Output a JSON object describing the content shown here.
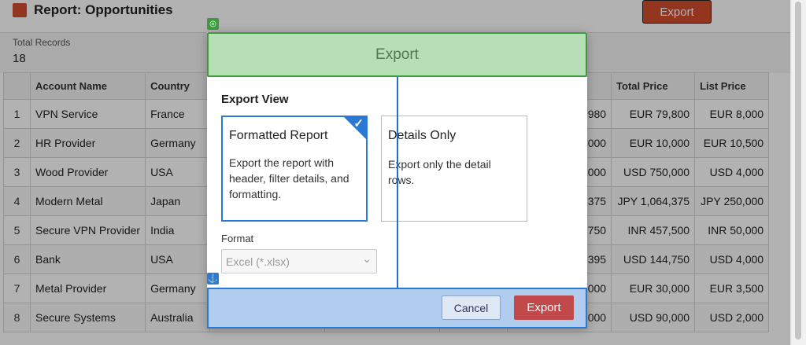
{
  "report": {
    "title": "Report: Opportunities",
    "export_label": "Export",
    "total_records_label": "Total Records",
    "total_records_value": "18"
  },
  "table": {
    "columns": [
      "",
      "Account Name",
      "Country",
      "",
      "",
      "",
      "",
      "Total Price",
      "List Price"
    ],
    "rows": [
      [
        "1",
        "VPN Service",
        "France",
        "",
        "",
        "",
        "980",
        "EUR 79,800",
        "EUR 8,000"
      ],
      [
        "2",
        "HR Provider",
        "Germany",
        "",
        "",
        "",
        "000",
        "EUR 10,000",
        "EUR 10,500"
      ],
      [
        "3",
        "Wood Provider",
        "USA",
        "",
        "",
        "",
        "000",
        "USD 750,000",
        "USD 4,000"
      ],
      [
        "4",
        "Modern Metal",
        "Japan",
        "",
        "",
        "",
        "375",
        "JPY 1,064,375",
        "JPY 250,000"
      ],
      [
        "5",
        "Secure VPN Provider",
        "India",
        "",
        "",
        "",
        "750",
        "INR 457,500",
        "INR 50,000"
      ],
      [
        "6",
        "Bank",
        "USA",
        "",
        "",
        "",
        "395",
        "USD 144,750",
        "USD 4,000"
      ],
      [
        "7",
        "Metal Provider",
        "Germany",
        "",
        "",
        "",
        "000",
        "EUR 30,000",
        "EUR 3,500"
      ],
      [
        "8",
        "Secure Systems",
        "Australia",
        "",
        "",
        "",
        "000",
        "USD 90,000",
        "USD 2,000"
      ]
    ]
  },
  "modal": {
    "title": "Export",
    "section_label": "Export View",
    "options": [
      {
        "title": "Formatted Report",
        "description": "Export the report with header, filter details, and formatting.",
        "selected": true
      },
      {
        "title": "Details Only",
        "description": "Export only the detail rows.",
        "selected": false
      }
    ],
    "format_label": "Format",
    "format_value": "Excel (*.xlsx)",
    "cancel_label": "Cancel",
    "export_label": "Export"
  },
  "colors": {
    "accent": "#2a7ad5",
    "header_fill": "#b6dfb6",
    "header_border": "#3e9a3e",
    "footer_fill": "#b0cdf0",
    "export_button": "#c2494a",
    "brand": "#d44c2d"
  },
  "icons": {
    "header_marker": "target-icon",
    "footer_marker": "anchor-icon",
    "select_chevron": "chevron-down-icon",
    "selected_check": "check-icon"
  }
}
